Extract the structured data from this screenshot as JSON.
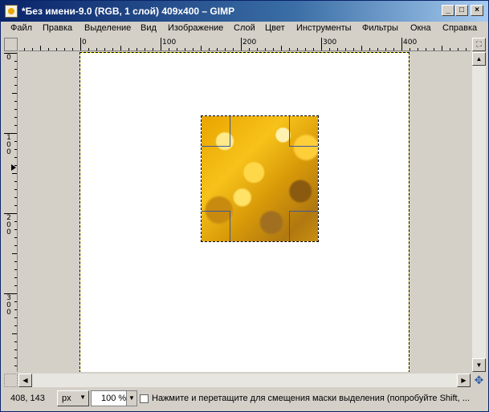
{
  "window": {
    "title": "*Без имени-9.0 (RGB, 1 слой) 409x400 – GIMP",
    "minimize_label": "_",
    "maximize_label": "□",
    "close_label": "×"
  },
  "menu": [
    {
      "label": "Файл"
    },
    {
      "label": "Правка"
    },
    {
      "label": "Выделение"
    },
    {
      "label": "Вид"
    },
    {
      "label": "Изображение"
    },
    {
      "label": "Слой"
    },
    {
      "label": "Цвет"
    },
    {
      "label": "Инструменты"
    },
    {
      "label": "Фильтры"
    },
    {
      "label": "Окна"
    },
    {
      "label": "Справка"
    }
  ],
  "ruler": {
    "h_labels": [
      "0",
      "100",
      "200",
      "300",
      "400"
    ],
    "v_labels": [
      "0",
      "100",
      "200",
      "300"
    ]
  },
  "scroll": {
    "up": "▲",
    "down": "▼",
    "left": "◀",
    "right": "▶",
    "nav": "✥"
  },
  "status": {
    "coords": "408, 143",
    "unit": "px",
    "zoom": "100 %",
    "message": "Нажмите и перетащите для смещения маски выделения (попробуйте Shift, ...",
    "dropdown_arrow": "▼"
  },
  "colors": {
    "titlebar_start": "#0a246a",
    "titlebar_end": "#a6caf0",
    "selection_marching": "#ffea00",
    "layer_gold": "#e9a400"
  }
}
